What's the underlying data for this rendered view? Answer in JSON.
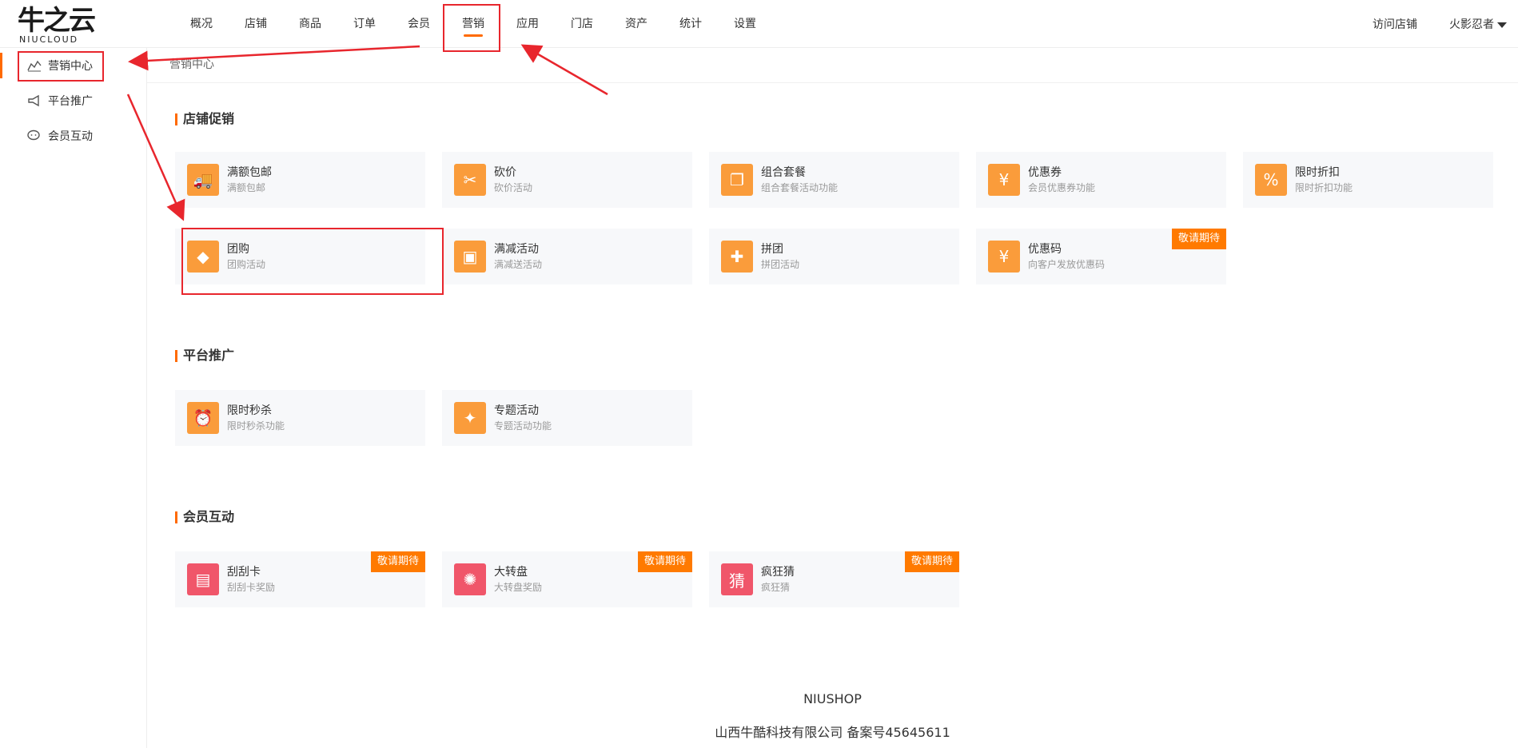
{
  "logo": {
    "big": "牛之云",
    "small": "NIUCLOUD"
  },
  "nav": [
    {
      "label": "概况"
    },
    {
      "label": "店铺"
    },
    {
      "label": "商品"
    },
    {
      "label": "订单"
    },
    {
      "label": "会员"
    },
    {
      "label": "营销"
    },
    {
      "label": "应用"
    },
    {
      "label": "门店"
    },
    {
      "label": "资产"
    },
    {
      "label": "统计"
    },
    {
      "label": "设置"
    }
  ],
  "top_right": {
    "visit": "访问店铺",
    "user": "火影忍者"
  },
  "sidebar": [
    {
      "label": "营销中心",
      "icon": "chart-icon"
    },
    {
      "label": "平台推广",
      "icon": "megaphone-icon"
    },
    {
      "label": "会员互动",
      "icon": "chat-icon"
    }
  ],
  "breadcrumb": "营销中心",
  "sections": [
    {
      "title": "店铺促销",
      "cards": [
        {
          "name": "满额包邮",
          "desc": "满额包邮",
          "icon": "truck-icon",
          "glyph": "🚚"
        },
        {
          "name": "砍价",
          "desc": "砍价活动",
          "icon": "price-tag-icon",
          "glyph": "✂"
        },
        {
          "name": "组合套餐",
          "desc": "组合套餐活动功能",
          "icon": "bundle-icon",
          "glyph": "❐"
        },
        {
          "name": "优惠券",
          "desc": "会员优惠券功能",
          "icon": "coupon-icon",
          "glyph": "¥"
        },
        {
          "name": "限时折扣",
          "desc": "限时折扣功能",
          "icon": "discount-icon",
          "glyph": "%"
        },
        {
          "name": "团购",
          "desc": "团购活动",
          "icon": "tag-icon",
          "glyph": "◆"
        },
        {
          "name": "满减活动",
          "desc": "满减送活动",
          "icon": "ticket-icon",
          "glyph": "▣"
        },
        {
          "name": "拼团",
          "desc": "拼团活动",
          "icon": "puzzle-icon",
          "glyph": "✚"
        },
        {
          "name": "优惠码",
          "desc": "向客户发放优惠码",
          "icon": "code-coupon-icon",
          "glyph": "¥",
          "badge": "敬请期待"
        }
      ]
    },
    {
      "title": "平台推广",
      "cards": [
        {
          "name": "限时秒杀",
          "desc": "限时秒杀功能",
          "icon": "alarm-clock-icon",
          "glyph": "⏰"
        },
        {
          "name": "专题活动",
          "desc": "专题活动功能",
          "icon": "bulb-icon",
          "glyph": "✦"
        }
      ]
    },
    {
      "title": "会员互动",
      "cards": [
        {
          "name": "刮刮卡",
          "desc": "刮刮卡奖励",
          "icon": "scratch-card-icon",
          "glyph": "▤",
          "badge": "敬请期待",
          "red": true
        },
        {
          "name": "大转盘",
          "desc": "大转盘奖励",
          "icon": "wheel-icon",
          "glyph": "✺",
          "badge": "敬请期待",
          "red": true
        },
        {
          "name": "疯狂猜",
          "desc": "疯狂猜",
          "icon": "guess-icon",
          "glyph": "猜",
          "badge": "敬请期待",
          "red": true
        }
      ]
    }
  ],
  "footer": {
    "brand": "NIUSHOP",
    "copyright": "山西牛酷科技有限公司 备案号45645611"
  }
}
